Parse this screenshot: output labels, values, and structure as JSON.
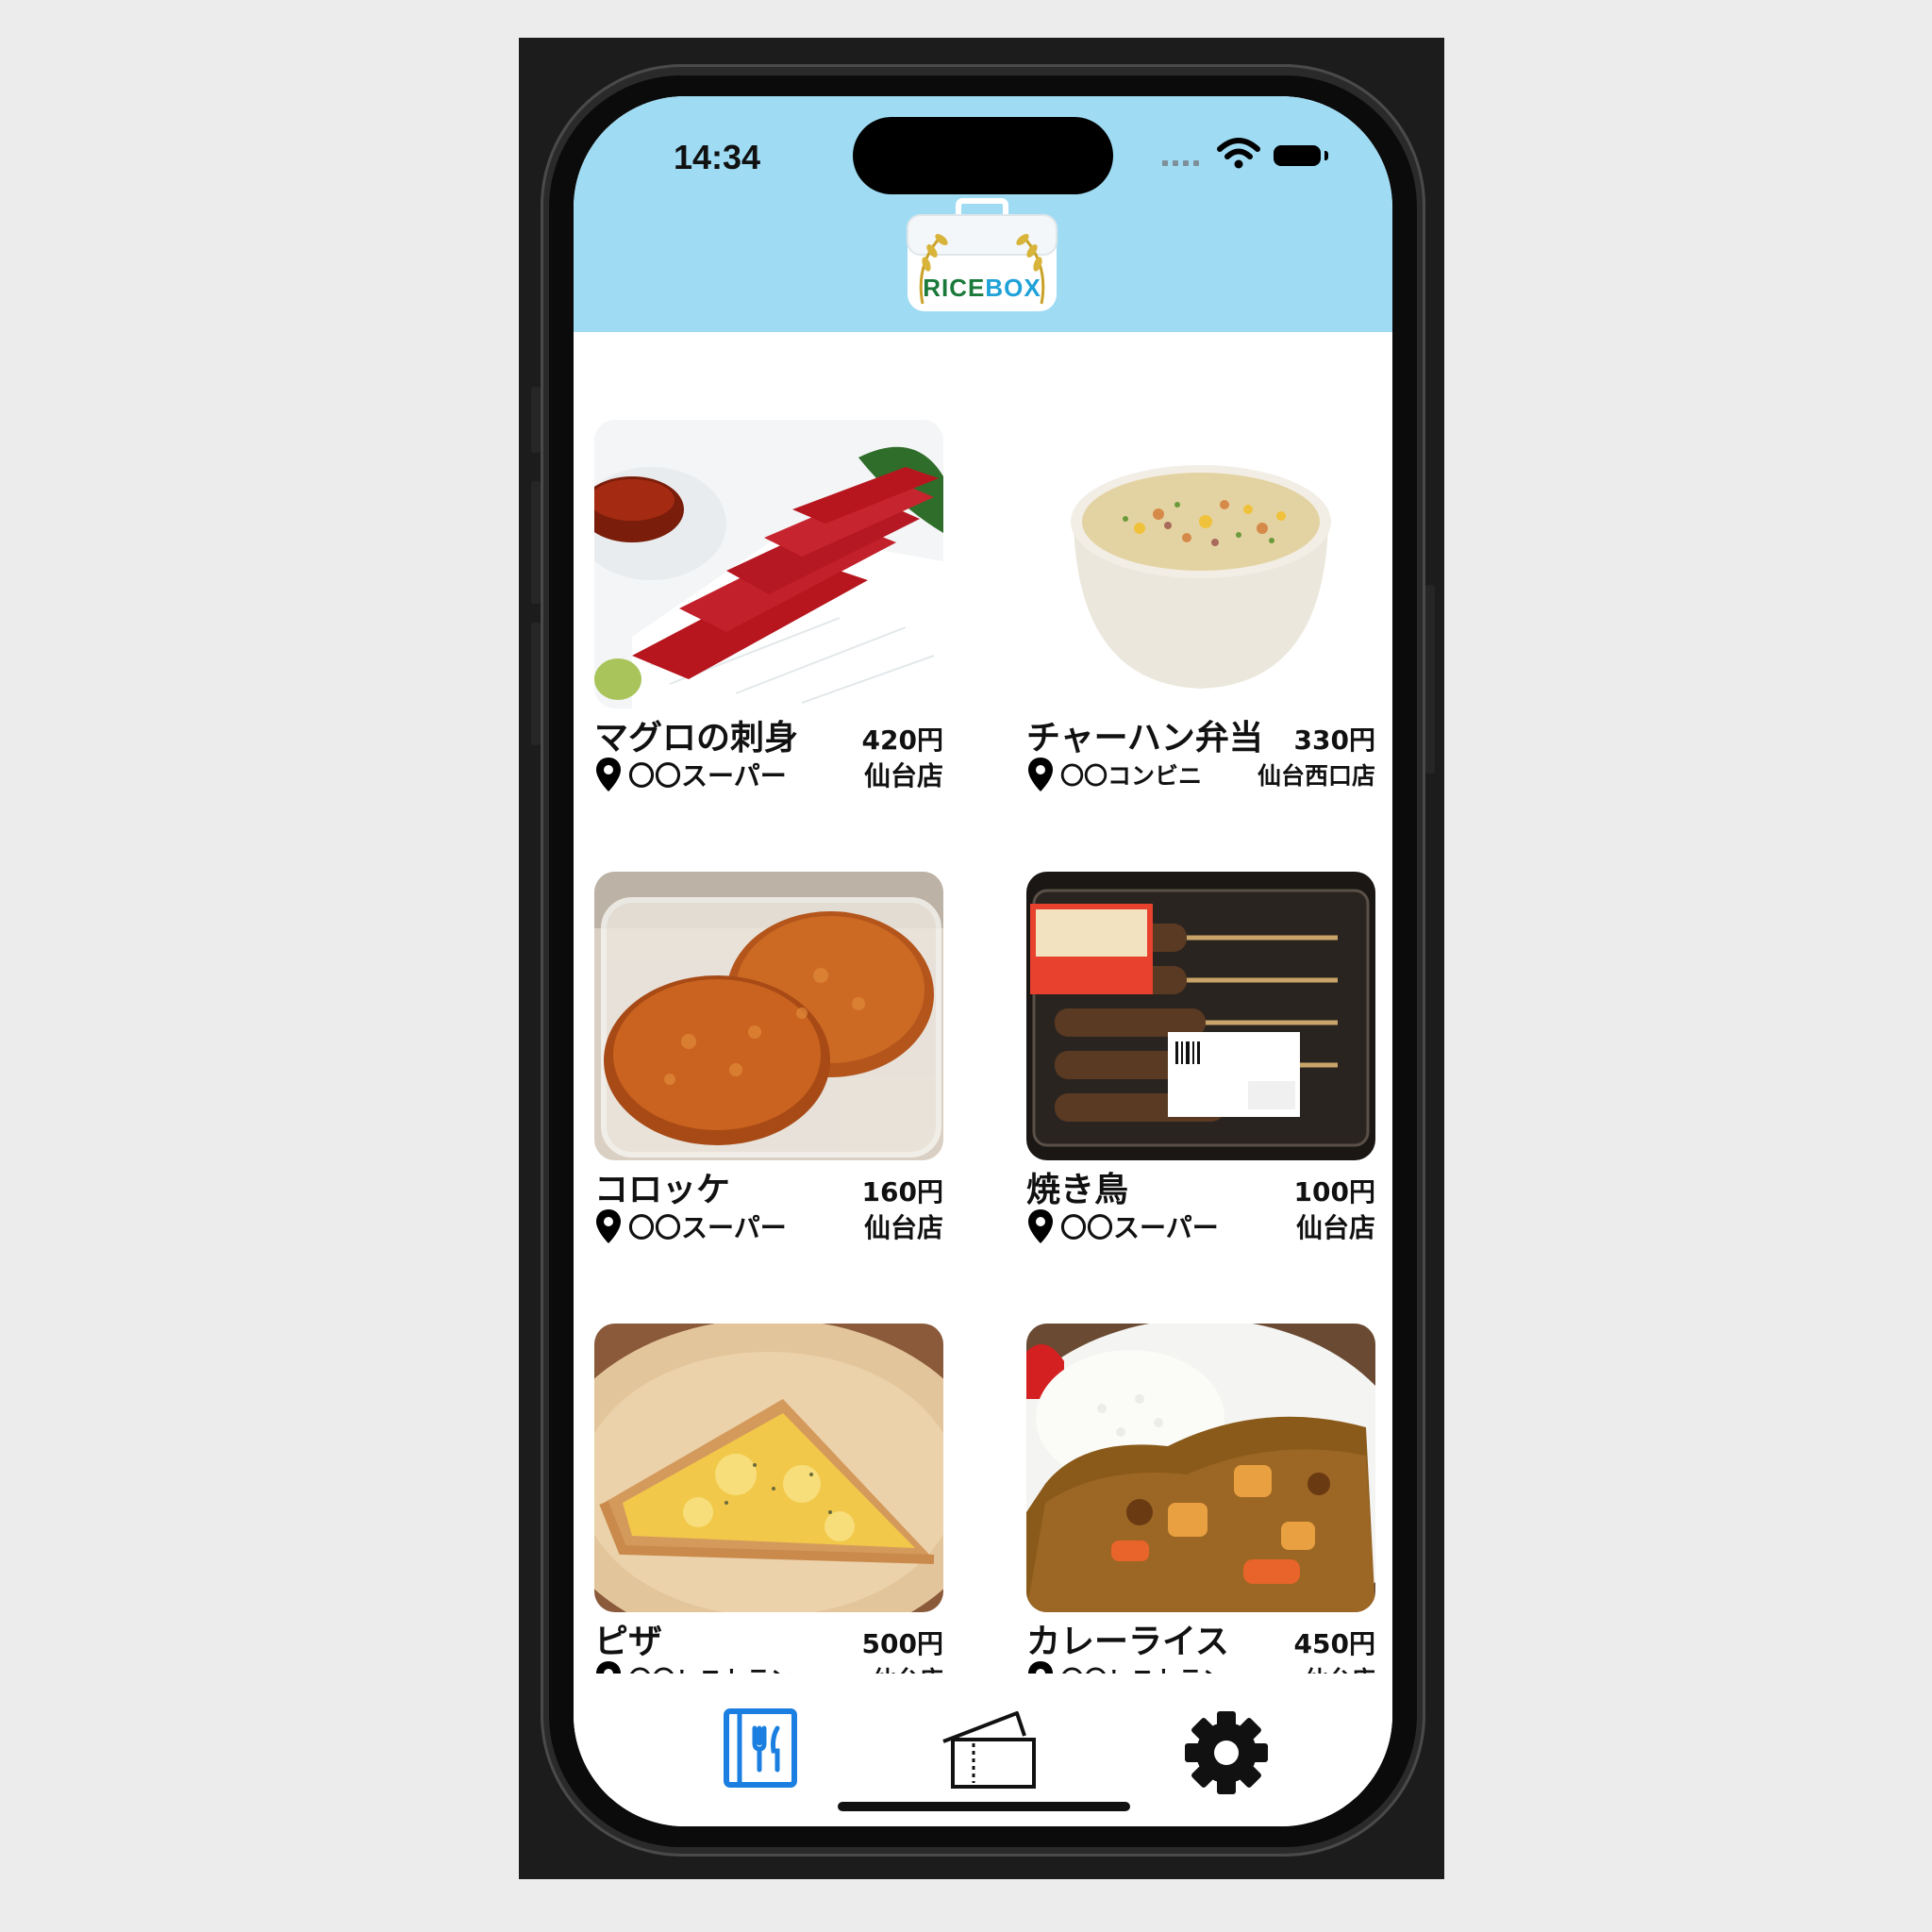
{
  "status_bar": {
    "time": "14:34"
  },
  "app": {
    "logo_text": "RICEBOX"
  },
  "colors": {
    "header_bg": "#9fdcf4",
    "accent": "#1a7fe0",
    "logo_green": "#1b7a3a",
    "logo_blue": "#1fa2d8"
  },
  "items": [
    {
      "name": "マグロの刺身",
      "price": "420円",
      "store": "〇〇スーパー",
      "branch": "仙台店"
    },
    {
      "name": "チャーハン弁当",
      "price": "330円",
      "store": "〇〇コンビニ",
      "branch": "仙台西口店"
    },
    {
      "name": "コロッケ",
      "price": "160円",
      "store": "〇〇スーパー",
      "branch": "仙台店"
    },
    {
      "name": "焼き鳥",
      "price": "100円",
      "store": "〇〇スーパー",
      "branch": "仙台店"
    },
    {
      "name": "ピザ",
      "price": "500円",
      "store": "〇〇レストラン",
      "branch": "仙台店"
    },
    {
      "name": "カレーライス",
      "price": "450円",
      "store": "〇〇レストラン",
      "branch": "仙台店"
    }
  ],
  "tabs": [
    {
      "icon": "menu-fork-knife-icon",
      "active": true
    },
    {
      "icon": "ticket-icon",
      "active": false
    },
    {
      "icon": "gear-icon",
      "active": false
    }
  ]
}
